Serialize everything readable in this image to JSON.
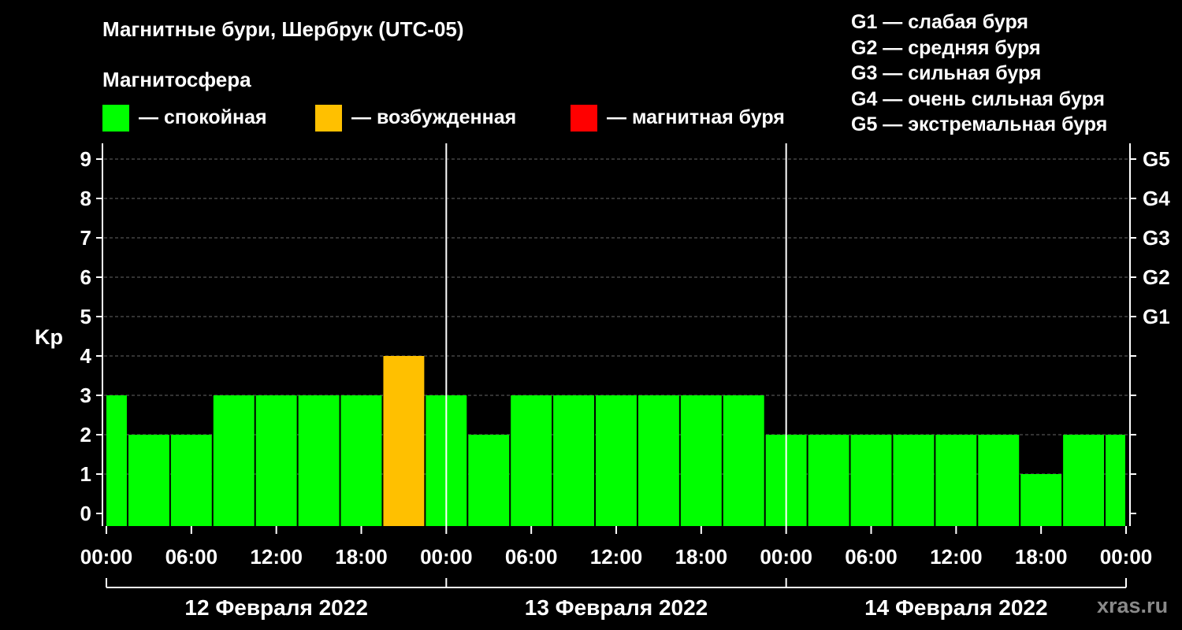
{
  "title": "Магнитные бури, Шербрук (UTC-05)",
  "magnetosphere_label": "Магнитосфера",
  "legend": [
    {
      "label": "— спокойная",
      "color": "#00ff00"
    },
    {
      "label": "— возбужденная",
      "color": "#ffc000"
    },
    {
      "label": "— магнитная буря",
      "color": "#ff0000"
    }
  ],
  "g_scale": [
    "G1 — слабая буря",
    "G2 — средняя буря",
    "G3 — сильная буря",
    "G4 — очень сильная буря",
    "G5 — экстремальная буря"
  ],
  "watermark": "xras.ru",
  "chart_data": {
    "type": "bar",
    "ylabel": "Kp",
    "ylim": [
      0,
      9
    ],
    "yticks": [
      "0",
      "1",
      "2",
      "3",
      "4",
      "5",
      "6",
      "7",
      "8",
      "9"
    ],
    "right_ticks": [
      {
        "y": 5,
        "label": "G1"
      },
      {
        "y": 6,
        "label": "G2"
      },
      {
        "y": 7,
        "label": "G3"
      },
      {
        "y": 8,
        "label": "G4"
      },
      {
        "y": 9,
        "label": "G5"
      }
    ],
    "x_tick_labels": [
      "00:00",
      "06:00",
      "12:00",
      "18:00",
      "00:00",
      "06:00",
      "12:00",
      "18:00",
      "00:00",
      "06:00",
      "12:00",
      "18:00",
      "00:00"
    ],
    "days": [
      "12 Февраля 2022",
      "13 Февраля 2022",
      "14 Февраля 2022"
    ],
    "bar_hours": [
      0,
      3,
      6,
      9,
      12,
      15,
      18,
      21,
      24,
      27,
      30,
      33,
      36,
      39,
      42,
      45,
      48,
      51,
      54,
      57,
      60,
      63,
      66,
      69,
      72
    ],
    "values": [
      3,
      2,
      2,
      3,
      3,
      3,
      3,
      4,
      3,
      2,
      3,
      3,
      3,
      3,
      3,
      3,
      2,
      2,
      2,
      2,
      2,
      2,
      1,
      2,
      2
    ],
    "colors": {
      "quiet": "#00ff00",
      "unsettled": "#ffc000",
      "storm": "#ff0000"
    },
    "grid": true
  }
}
